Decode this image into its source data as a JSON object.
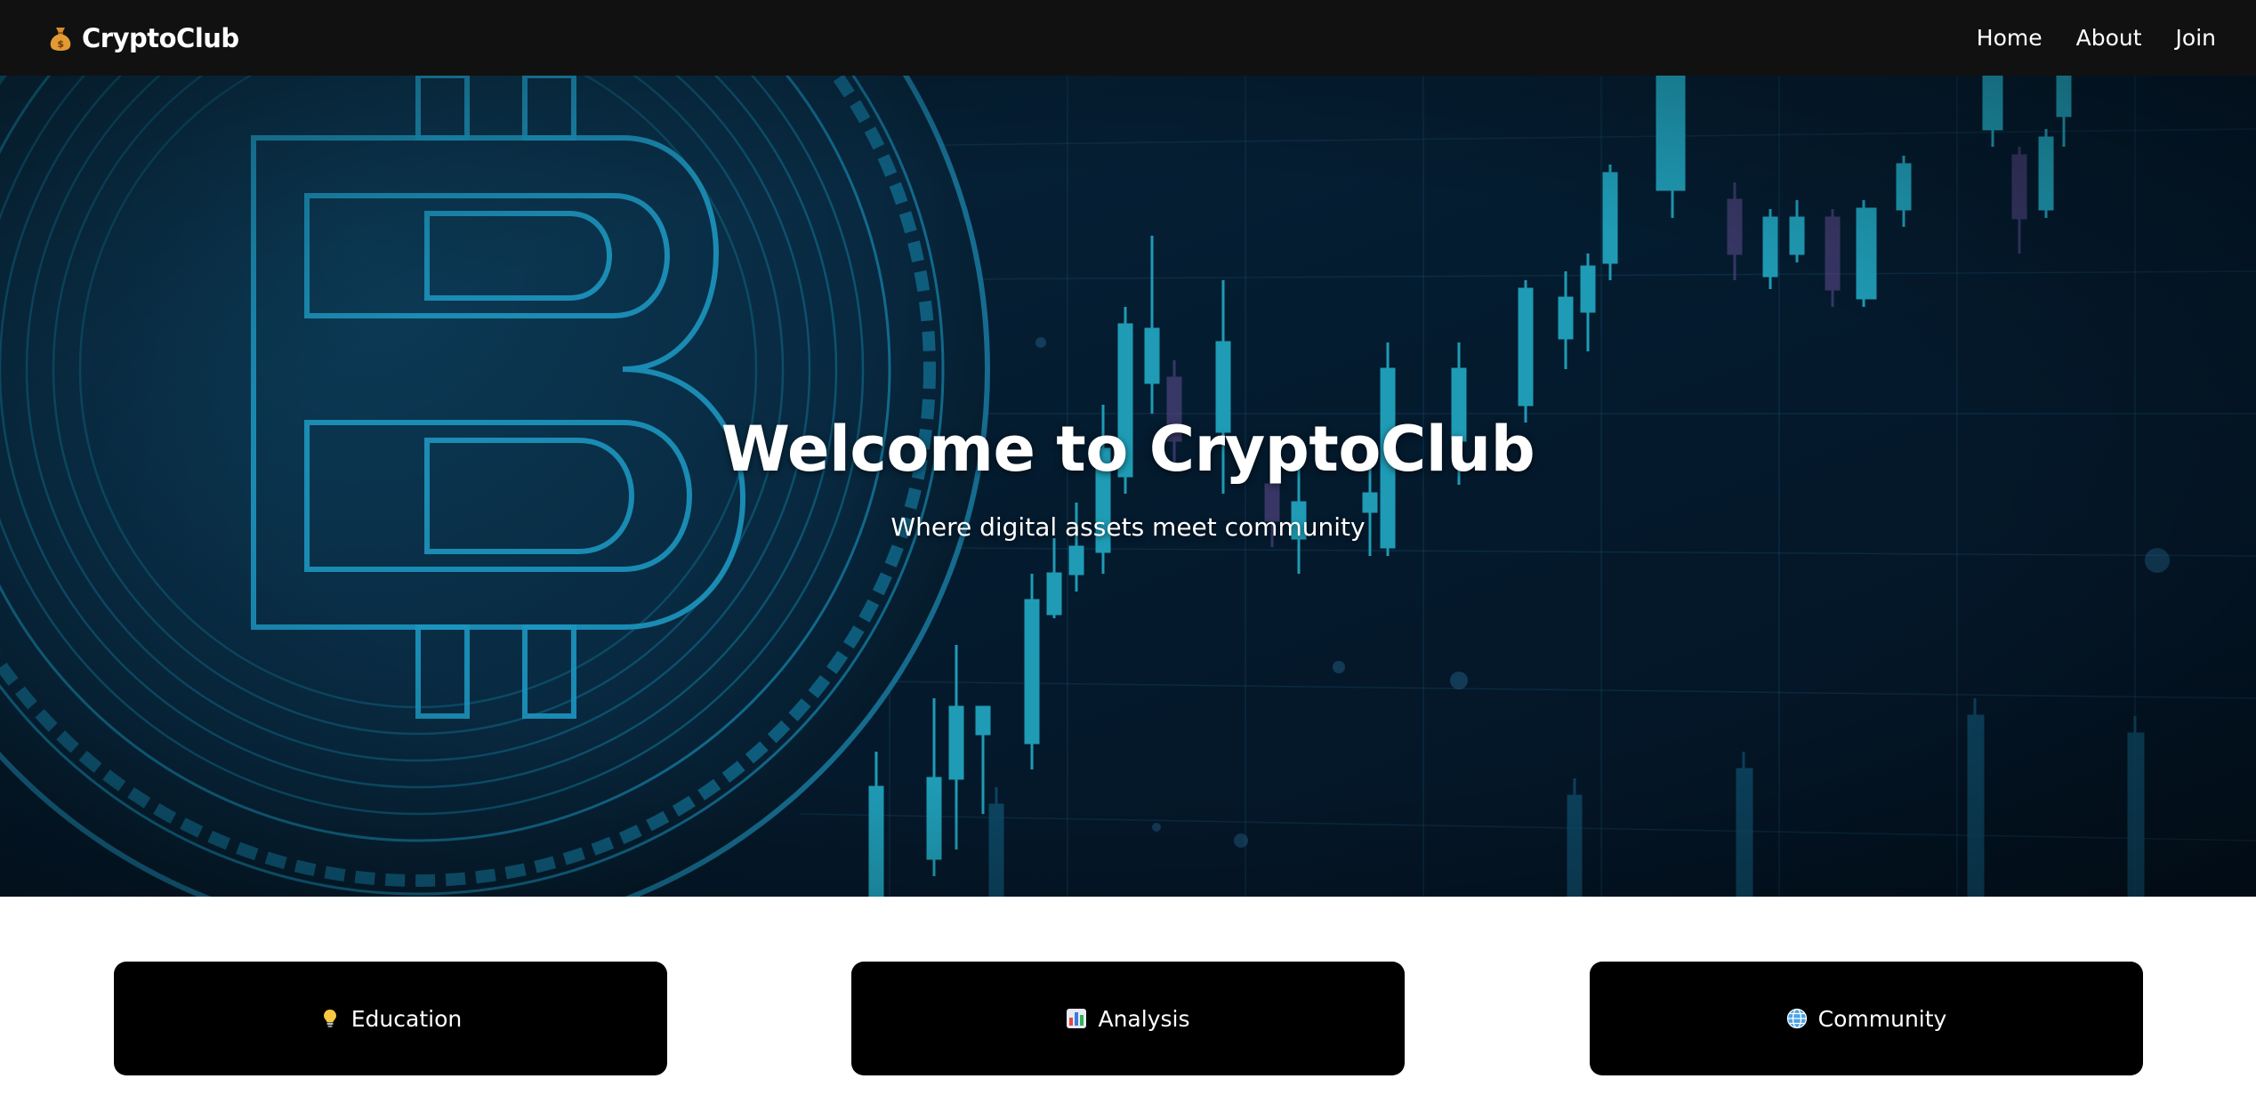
{
  "navbar": {
    "brand_icon": "money-bag-icon",
    "brand": "CryptoClub",
    "links": [
      {
        "label": "Home"
      },
      {
        "label": "About"
      },
      {
        "label": "Join"
      }
    ]
  },
  "hero": {
    "title": "Welcome to CryptoClub",
    "subtitle": "Where digital assets meet community",
    "background": "bitcoin-coin-and-candlestick-chart"
  },
  "features": [
    {
      "icon": "lightbulb-icon",
      "label": "Education"
    },
    {
      "icon": "bar-chart-icon",
      "label": "Analysis"
    },
    {
      "icon": "globe-icon",
      "label": "Community"
    }
  ],
  "colors": {
    "navbar_bg": "#111111",
    "card_bg": "#000000",
    "hero_bg": "#04182a",
    "accent_cyan": "#2bb3c8"
  }
}
